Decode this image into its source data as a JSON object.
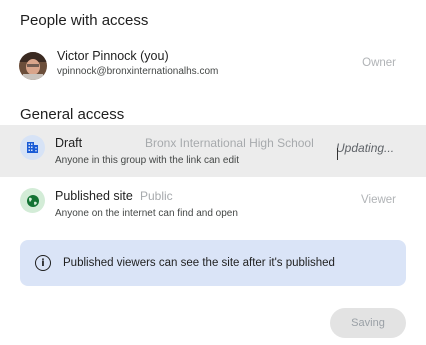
{
  "people_section": {
    "title": "People with access",
    "person": {
      "name": "Victor Pinnock (you)",
      "email": "vpinnock@bronxinternationalhs.com",
      "role": "Owner"
    }
  },
  "general_section": {
    "title": "General access",
    "draft": {
      "title": "Draft",
      "scope": "Bronx International High School",
      "description": "Anyone in this group with the link can edit",
      "status": "Updating...",
      "icon": "building-icon"
    },
    "published": {
      "title": "Published site",
      "scope": "Public",
      "description": "Anyone on the internet can find and open",
      "role": "Viewer",
      "icon": "globe-icon"
    }
  },
  "info_banner": {
    "text": "Published viewers can see the site after it's published",
    "icon": "info-icon"
  },
  "footer": {
    "saving_label": "Saving"
  },
  "colors": {
    "draft_icon_bg": "#d7e3f6",
    "draft_icon_fg": "#1a5bd6",
    "published_icon_bg": "#d3ecd7",
    "published_icon_fg": "#137333",
    "banner_bg": "#dae4f7",
    "selected_row_bg": "#ececec"
  }
}
